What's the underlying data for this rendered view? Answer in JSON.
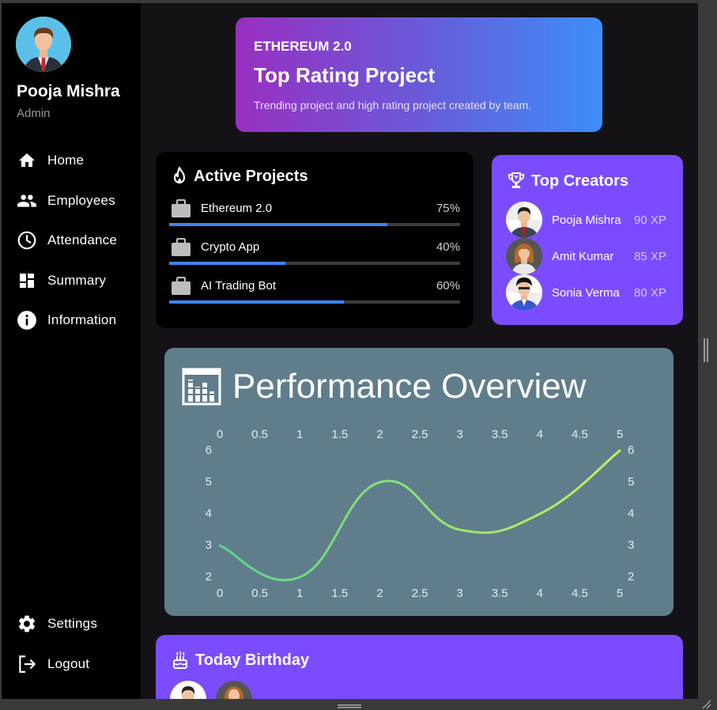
{
  "user": {
    "name": "Pooja Mishra",
    "role": "Admin"
  },
  "nav": {
    "items": [
      {
        "label": "Home",
        "icon": "home-icon"
      },
      {
        "label": "Employees",
        "icon": "people-icon"
      },
      {
        "label": "Attendance",
        "icon": "clock-icon"
      },
      {
        "label": "Summary",
        "icon": "dashboard-icon"
      },
      {
        "label": "Information",
        "icon": "info-icon"
      }
    ],
    "bottom": [
      {
        "label": "Settings",
        "icon": "gear-icon"
      },
      {
        "label": "Logout",
        "icon": "logout-icon"
      }
    ]
  },
  "banner": {
    "eyebrow": "ETHEREUM 2.0",
    "title": "Top Rating Project",
    "subtitle": "Trending project and high rating project created by team."
  },
  "projects": {
    "title": "Active Projects",
    "items": [
      {
        "name": "Ethereum 2.0",
        "percent_label": "75%",
        "progress": 0.75
      },
      {
        "name": "Crypto App",
        "percent_label": "40%",
        "progress": 0.4
      },
      {
        "name": "AI Trading Bot",
        "percent_label": "60%",
        "progress": 0.6
      }
    ]
  },
  "creators": {
    "title": "Top Creators",
    "items": [
      {
        "name": "Pooja Mishra",
        "xp": "90 XP"
      },
      {
        "name": "Amit Kumar",
        "xp": "85 XP"
      },
      {
        "name": "Sonia Verma",
        "xp": "80 XP"
      }
    ]
  },
  "performance": {
    "title": "Performance Overview"
  },
  "birthday": {
    "title": "Today Birthday"
  },
  "colors": {
    "accent_purple": "#7b4cff",
    "progress_blue": "#3f84f0",
    "chart_panel": "#607d8b",
    "line_start": "#58d68d",
    "line_end": "#c6ef5a"
  },
  "chart_data": {
    "type": "line",
    "title": "Performance Overview",
    "x": [
      0,
      1,
      2,
      3,
      4,
      5
    ],
    "series": [
      {
        "values": [
          3,
          2,
          5,
          3.5,
          4,
          6
        ]
      }
    ],
    "x_ticks": [
      "0",
      "0.5",
      "1",
      "1.5",
      "2",
      "2.5",
      "3",
      "3.5",
      "4",
      "4.5",
      "5"
    ],
    "y_ticks": [
      "2",
      "3",
      "4",
      "5",
      "6"
    ],
    "xlim": [
      0,
      5
    ],
    "ylim": [
      2,
      6
    ],
    "ticks_on_all_sides": true,
    "grid": false,
    "curved": true
  }
}
